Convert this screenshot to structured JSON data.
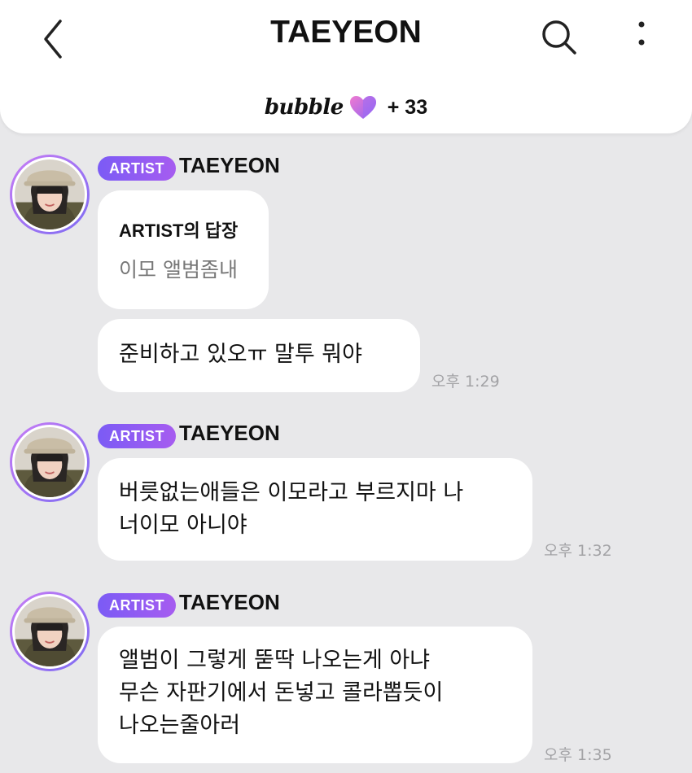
{
  "header": {
    "title": "TAEYEON",
    "brand": "bubble",
    "subscriber_count": "+ 33",
    "accent_colors": {
      "badge_start": "#7b5bf5",
      "badge_end": "#a65cf0",
      "heart_pink": "#f07ad0",
      "heart_purple": "#8f63f3"
    },
    "icons": {
      "back": "chevron-left-icon",
      "search": "search-icon",
      "more": "more-vertical-icon",
      "brand": "heart-icon"
    }
  },
  "messages": [
    {
      "badge": "ARTIST",
      "sender": "TAEYEON",
      "reply": {
        "title": "ARTIST의 답장",
        "quote": "이모 앨범좀내"
      },
      "text": "준비하고 있오ㅠ 말투 뭐야",
      "time": "오후 1:29"
    },
    {
      "badge": "ARTIST",
      "sender": "TAEYEON",
      "lines": [
        "버릇없는애들은 이모라고 부르지마 나",
        "너이모 아니야"
      ],
      "time": "오후 1:32"
    },
    {
      "badge": "ARTIST",
      "sender": "TAEYEON",
      "lines": [
        "앨범이 그렇게 뚣딱 나오는게 아냐",
        "무슨 자판기에서 돈넣고 콜라뽑듯이",
        "나오는줄아러"
      ],
      "time": "오후 1:35"
    }
  ]
}
